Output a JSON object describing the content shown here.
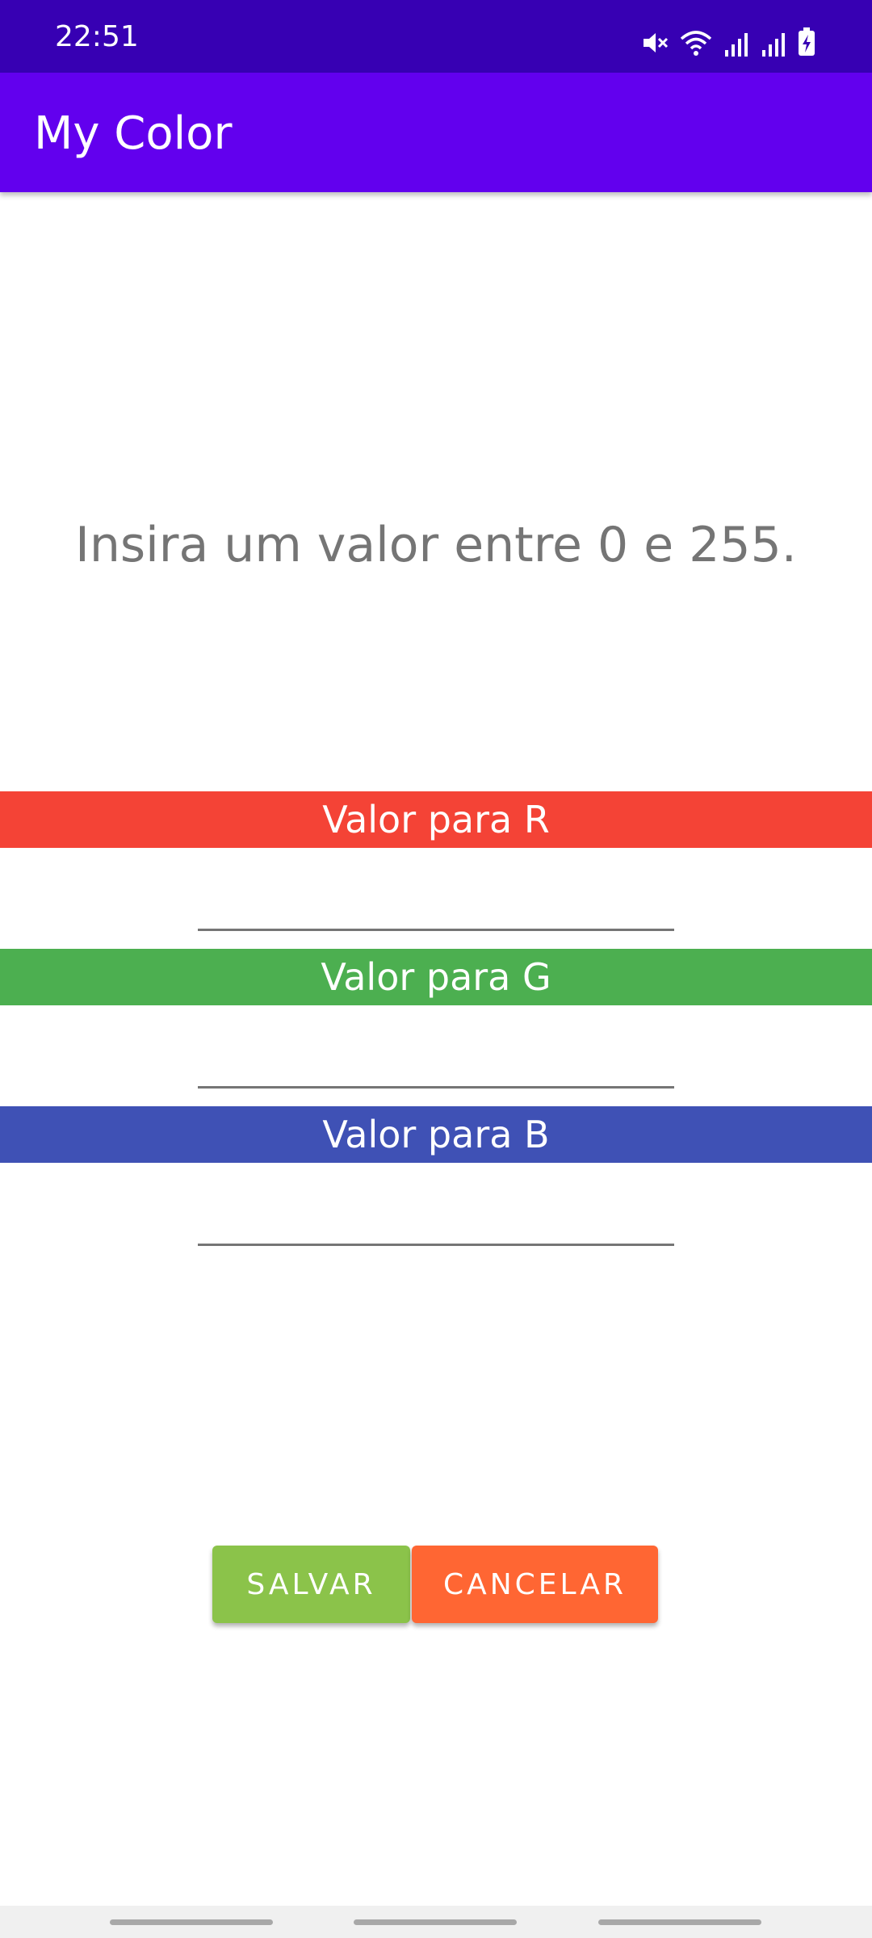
{
  "status_bar": {
    "time": "22:51",
    "icons": [
      "mute-icon",
      "wifi-icon",
      "signal-icon",
      "signal-icon",
      "battery-charging-icon"
    ]
  },
  "app_bar": {
    "title": "My Color"
  },
  "main": {
    "instructions": "Insira um valor entre 0 e 255.",
    "channels": [
      {
        "label": "Valor para R",
        "value": "",
        "color": "#f44336"
      },
      {
        "label": "Valor para G",
        "value": "",
        "color": "#4caf50"
      },
      {
        "label": "Valor para B",
        "value": "",
        "color": "#3f51b5"
      }
    ]
  },
  "actions": {
    "save_label": "SALVAR",
    "save_color": "#8bc34a",
    "cancel_label": "CANCELAR",
    "cancel_color": "#ff6633"
  },
  "theme": {
    "status_bar_color": "#3700b3",
    "app_bar_color": "#6200ee"
  }
}
